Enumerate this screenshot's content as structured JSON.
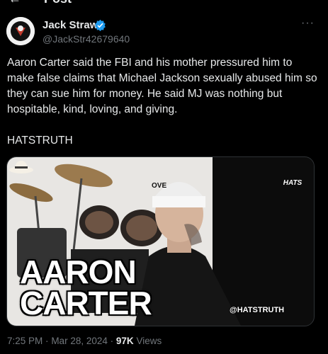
{
  "header": {
    "title": "Post",
    "back_glyph": "←"
  },
  "author": {
    "name": "Jack Straw",
    "handle": "@JackStr42679640",
    "verified": true,
    "verified_color": "#1d9bf0"
  },
  "more_glyph": "···",
  "tweet": {
    "text": "Aaron Carter said the FBI and his mother pressured him to make false claims that Michael Jackson sexually abused him so they can sue him for money. He said MJ was nothing but hospitable, kind, loving, and giving.\n\nHATSTRUTH"
  },
  "media": {
    "title_line1": "AARON",
    "title_line2": "CARTER",
    "logo_label": "HATS",
    "watermark": "@HATSTRUTH",
    "beanie_text": "OVE"
  },
  "meta": {
    "time": "7:25 PM",
    "sep1": "·",
    "date": "Mar 28, 2024",
    "sep2": "·",
    "views_count": "97K",
    "views_label": "Views"
  }
}
